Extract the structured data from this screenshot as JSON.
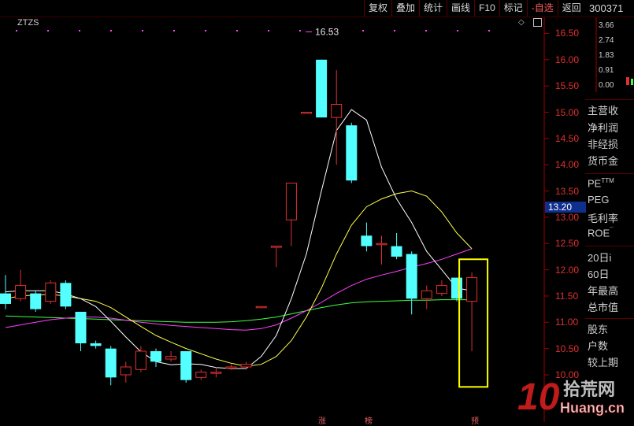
{
  "toolbar": {
    "buttons": [
      "复权",
      "叠加",
      "统计",
      "画线",
      "F10",
      "标记",
      "-自选",
      "返回"
    ],
    "stock_code": "300371"
  },
  "indicator": "ZTZS",
  "colors": {
    "up": "#e03030",
    "down": "#54ffff",
    "ma5": "#ffffff",
    "ma10": "#ffff50",
    "ma20": "#ff40ff",
    "ma60": "#40ff40",
    "highlight": "#ffff00",
    "price_tag_bg": "#0f2f8f"
  },
  "chart_data": {
    "type": "candlestick",
    "ylim": [
      9.8,
      16.7
    ],
    "yticks": [
      "16.50",
      "16.00",
      "15.50",
      "15.00",
      "14.50",
      "14.00",
      "13.50",
      "13.00",
      "12.50",
      "12.00",
      "11.50",
      "11.00",
      "10.50",
      "10.00"
    ],
    "current_price_label": "13.20",
    "current_price": 13.2,
    "max_label": "16.53",
    "max_value": 16.53,
    "candles": [
      {
        "o": 11.55,
        "c": 11.35,
        "h": 11.9,
        "l": 11.25
      },
      {
        "o": 11.45,
        "c": 11.7,
        "h": 12.0,
        "l": 11.4
      },
      {
        "o": 11.55,
        "c": 11.25,
        "h": 11.6,
        "l": 11.2
      },
      {
        "o": 11.4,
        "c": 11.75,
        "h": 11.8,
        "l": 11.35
      },
      {
        "o": 11.75,
        "c": 11.3,
        "h": 11.8,
        "l": 11.25
      },
      {
        "o": 11.2,
        "c": 10.6,
        "h": 11.2,
        "l": 10.45
      },
      {
        "o": 10.6,
        "c": 10.55,
        "h": 10.65,
        "l": 10.5
      },
      {
        "o": 10.5,
        "c": 9.95,
        "h": 10.55,
        "l": 9.8
      },
      {
        "o": 10.0,
        "c": 10.15,
        "h": 10.25,
        "l": 9.85
      },
      {
        "o": 10.1,
        "c": 10.45,
        "h": 10.55,
        "l": 10.05
      },
      {
        "o": 10.45,
        "c": 10.25,
        "h": 10.5,
        "l": 10.15
      },
      {
        "o": 10.3,
        "c": 10.35,
        "h": 10.45,
        "l": 10.25
      },
      {
        "o": 10.45,
        "c": 9.9,
        "h": 10.45,
        "l": 9.85
      },
      {
        "o": 9.95,
        "c": 10.05,
        "h": 10.1,
        "l": 9.9
      },
      {
        "o": 10.05,
        "c": 10.05,
        "h": 10.15,
        "l": 9.95
      },
      {
        "o": 10.15,
        "c": 10.15,
        "h": 10.2,
        "l": 10.1
      },
      {
        "o": 10.15,
        "c": 10.2,
        "h": 10.25,
        "l": 10.1
      },
      {
        "o": 11.3,
        "c": 11.3,
        "h": 11.3,
        "l": 11.3
      },
      {
        "o": 12.45,
        "c": 12.45,
        "h": 12.45,
        "l": 12.05
      },
      {
        "o": 12.95,
        "c": 13.65,
        "h": 13.65,
        "l": 12.45
      },
      {
        "o": 15.0,
        "c": 15.0,
        "h": 15.0,
        "l": 15.0
      },
      {
        "o": 16.0,
        "c": 14.9,
        "h": 16.0,
        "l": 14.9
      },
      {
        "o": 14.9,
        "c": 15.15,
        "h": 15.8,
        "l": 14.0
      },
      {
        "o": 14.75,
        "c": 13.7,
        "h": 14.8,
        "l": 13.65
      },
      {
        "o": 12.65,
        "c": 12.45,
        "h": 12.9,
        "l": 12.35
      },
      {
        "o": 12.5,
        "c": 12.5,
        "h": 12.65,
        "l": 12.1
      },
      {
        "o": 12.45,
        "c": 12.25,
        "h": 12.7,
        "l": 12.2
      },
      {
        "o": 12.3,
        "c": 11.45,
        "h": 12.35,
        "l": 11.15
      },
      {
        "o": 11.45,
        "c": 11.6,
        "h": 11.7,
        "l": 11.25
      },
      {
        "o": 11.55,
        "c": 11.7,
        "h": 11.8,
        "l": 11.5
      },
      {
        "o": 11.85,
        "c": 11.45,
        "h": 11.85,
        "l": 11.4
      },
      {
        "o": 11.4,
        "c": 11.85,
        "h": 11.95,
        "l": 10.45
      }
    ],
    "ma5": [
      11.58,
      11.6,
      11.6,
      11.6,
      11.54,
      11.45,
      11.3,
      11.02,
      10.72,
      10.44,
      10.25,
      10.19,
      10.21,
      10.2,
      10.14,
      10.12,
      10.12,
      10.35,
      10.75,
      11.45,
      12.3,
      13.5,
      14.65,
      15.05,
      14.85,
      13.95,
      13.35,
      12.9,
      12.35,
      12.0,
      11.65,
      11.6
    ],
    "ma10": [
      11.45,
      11.5,
      11.52,
      11.53,
      11.5,
      11.45,
      11.4,
      11.28,
      11.1,
      10.92,
      10.75,
      10.62,
      10.5,
      10.4,
      10.3,
      10.22,
      10.16,
      10.2,
      10.35,
      10.65,
      11.1,
      11.65,
      12.3,
      12.85,
      13.2,
      13.35,
      13.45,
      13.5,
      13.4,
      13.1,
      12.7,
      12.4
    ],
    "ma20": [
      10.9,
      10.95,
      11.0,
      11.05,
      11.08,
      11.1,
      11.1,
      11.08,
      11.04,
      11.0,
      10.97,
      10.94,
      10.92,
      10.9,
      10.88,
      10.86,
      10.85,
      10.88,
      10.95,
      11.08,
      11.22,
      11.38,
      11.55,
      11.7,
      11.82,
      11.9,
      11.97,
      12.05,
      12.12,
      12.2,
      12.3,
      12.4
    ],
    "ma60": [
      11.12,
      11.11,
      11.1,
      11.09,
      11.08,
      11.07,
      11.06,
      11.05,
      11.04,
      11.03,
      11.02,
      11.01,
      11.0,
      11.0,
      11.0,
      11.01,
      11.03,
      11.06,
      11.1,
      11.16,
      11.22,
      11.28,
      11.33,
      11.37,
      11.39,
      11.4,
      11.41,
      11.42,
      11.42,
      11.43,
      11.43,
      11.43
    ]
  },
  "mini": {
    "ticks": [
      "3.66",
      "2.74",
      "1.83",
      "0.91",
      "0.00"
    ]
  },
  "side_panel": {
    "labels": [
      "主营收",
      "净利润",
      "非经损",
      "货币金",
      "PE",
      "PEG",
      "毛利率",
      "ROE",
      "20日i",
      "60日",
      "年最高",
      "总市值",
      "股东",
      "户数",
      "较上期"
    ],
    "pe_mark": "TTM",
    "roe_mark": "¯"
  },
  "badges": [
    "涨",
    "榜",
    "预"
  ],
  "watermark": {
    "number": "10",
    "cn": "拾荒网",
    "url": "Huang.cn"
  }
}
